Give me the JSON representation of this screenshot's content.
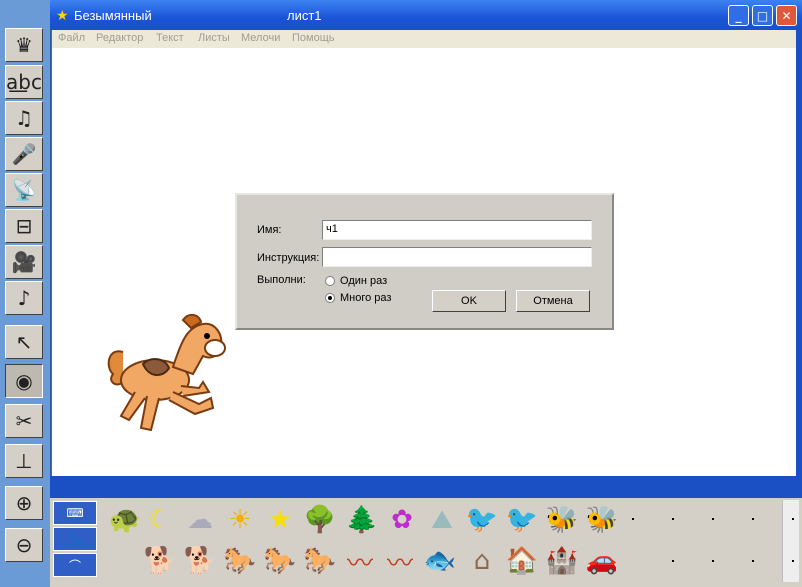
{
  "window": {
    "title": "Безымянный",
    "sheet": "лист1",
    "minimize_icon": "_",
    "maximize_icon": "□",
    "close_icon": "✕"
  },
  "menu": [
    "Файл",
    "Редактор",
    "Текст",
    "Листы",
    "Мелочи",
    "Помощь"
  ],
  "left_toolbar": [
    {
      "name": "new-turtle-icon",
      "glyph": "♛"
    },
    {
      "name": "text-box-icon",
      "glyph": "a͟bc"
    },
    {
      "name": "music-note-icon",
      "glyph": "♫"
    },
    {
      "name": "microphone-icon",
      "glyph": "🎤"
    },
    {
      "name": "satellite-dish-icon",
      "glyph": "📡"
    },
    {
      "name": "slider-icon",
      "glyph": "⊟"
    },
    {
      "name": "video-camera-icon",
      "glyph": "🎥"
    },
    {
      "name": "cd-music-icon",
      "glyph": "♪"
    },
    {
      "name": "pointer-icon",
      "glyph": "↖"
    },
    {
      "name": "eye-icon",
      "glyph": "◉"
    },
    {
      "name": "scissors-icon",
      "glyph": "✂"
    },
    {
      "name": "stamp-icon",
      "glyph": "⊥"
    },
    {
      "name": "zoom-in-icon",
      "glyph": "⊕"
    },
    {
      "name": "zoom-out-icon",
      "glyph": "⊖"
    }
  ],
  "dialog": {
    "name_label": "Имя:",
    "name_value": "ч1",
    "instruction_label": "Инструкция:",
    "instruction_value": "",
    "run_label": "Выполни:",
    "option_once": "Один раз",
    "option_many": "Много раз",
    "selected_option": "Много раз",
    "ok_label": "OK",
    "cancel_label": "Отмена"
  },
  "palette": {
    "tabs": [
      {
        "name": "keyboard-tab-icon",
        "glyph": "⌨"
      },
      {
        "name": "dog-tab-icon",
        "glyph": "🐾"
      },
      {
        "name": "shape-tab-icon",
        "glyph": "⌒"
      }
    ],
    "row1": [
      {
        "name": "turtle-icon",
        "glyph": "🐢"
      },
      {
        "name": "moon-icon",
        "glyph": "☾"
      },
      {
        "name": "cloud-icon",
        "glyph": "☁"
      },
      {
        "name": "sun-icon",
        "glyph": "☀"
      },
      {
        "name": "star-icon",
        "glyph": "★"
      },
      {
        "name": "tree-icon",
        "glyph": "🌳"
      },
      {
        "name": "pine-tree-icon",
        "glyph": "🌲"
      },
      {
        "name": "flower-icon",
        "glyph": "✿"
      },
      {
        "name": "mountain-icon",
        "glyph": "⛰"
      },
      {
        "name": "red-bird-icon",
        "glyph": "🐦"
      },
      {
        "name": "red-bird-2-icon",
        "glyph": "🐦"
      },
      {
        "name": "bee-icon",
        "glyph": "🐝"
      },
      {
        "name": "bee-2-icon",
        "glyph": "🐝"
      }
    ],
    "row2": [
      {
        "name": "dog-icon",
        "glyph": "🐕"
      },
      {
        "name": "dog-2-icon",
        "glyph": "🐕"
      },
      {
        "name": "horse-icon",
        "glyph": "🐎"
      },
      {
        "name": "horse-2-icon",
        "glyph": "🐎"
      },
      {
        "name": "horse-3-icon",
        "glyph": "🐎"
      },
      {
        "name": "snake-icon",
        "glyph": "〰"
      },
      {
        "name": "snake-2-icon",
        "glyph": "〰"
      },
      {
        "name": "fish-icon",
        "glyph": "🐟"
      },
      {
        "name": "hut-icon",
        "glyph": "⌂"
      },
      {
        "name": "house-icon",
        "glyph": "🏠"
      },
      {
        "name": "castle-icon",
        "glyph": "🏰"
      },
      {
        "name": "car-icon",
        "glyph": "🚗"
      }
    ]
  },
  "colors": {
    "titlebar": "#1b4fc4",
    "accent": "#3a6ea5",
    "dialog": "#cfcdc6"
  }
}
